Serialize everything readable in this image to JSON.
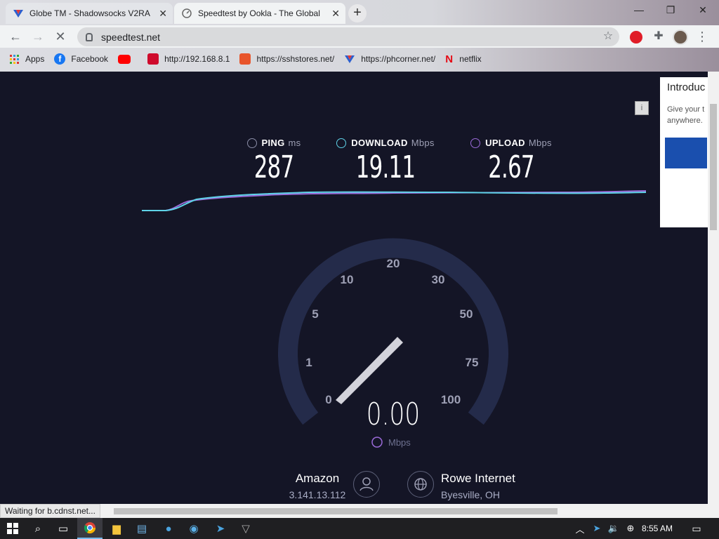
{
  "browser": {
    "tabs": [
      {
        "title": "Globe TM - Shadowsocks V2RA",
        "favicon": "vpn-logo-icon"
      },
      {
        "title": "Speedtest by Ookla - The Global",
        "favicon": "speedtest-icon"
      }
    ],
    "url": "speedtest.net",
    "bookmarks": [
      {
        "label": "Apps"
      },
      {
        "label": "Facebook"
      },
      {
        "label": ""
      },
      {
        "label": "http://192.168.8.1"
      },
      {
        "label": "https://sshstores.net/"
      },
      {
        "label": "https://phcorner.net/"
      },
      {
        "label": "netflix"
      }
    ]
  },
  "speedtest": {
    "ping": {
      "label": "PING",
      "unit": "ms",
      "value": "287"
    },
    "download": {
      "label": "DOWNLOAD",
      "unit": "Mbps",
      "value": "19.11"
    },
    "upload": {
      "label": "UPLOAD",
      "unit": "Mbps",
      "value": "2.67"
    },
    "gauge": {
      "ticks": [
        "0",
        "1",
        "5",
        "10",
        "20",
        "30",
        "50",
        "75",
        "100"
      ],
      "reading": "0.00",
      "unit": "Mbps",
      "needle_fraction": 0.0
    },
    "host": {
      "name": "Amazon",
      "ip": "3.141.13.112"
    },
    "isp": {
      "name": "Rowe Internet",
      "location": "Byesville, OH"
    }
  },
  "ad": {
    "title": "Introduc",
    "desc_line1": "Give your t",
    "desc_line2": "anywhere."
  },
  "status": {
    "text": "Waiting for b.cdnst.net..."
  },
  "taskbar": {
    "time": "8:55 AM"
  },
  "colors": {
    "background": "#141526",
    "gauge_track": "#242b4a",
    "download_line": "#5fd3e8",
    "upload_line": "#9b6ad9"
  }
}
